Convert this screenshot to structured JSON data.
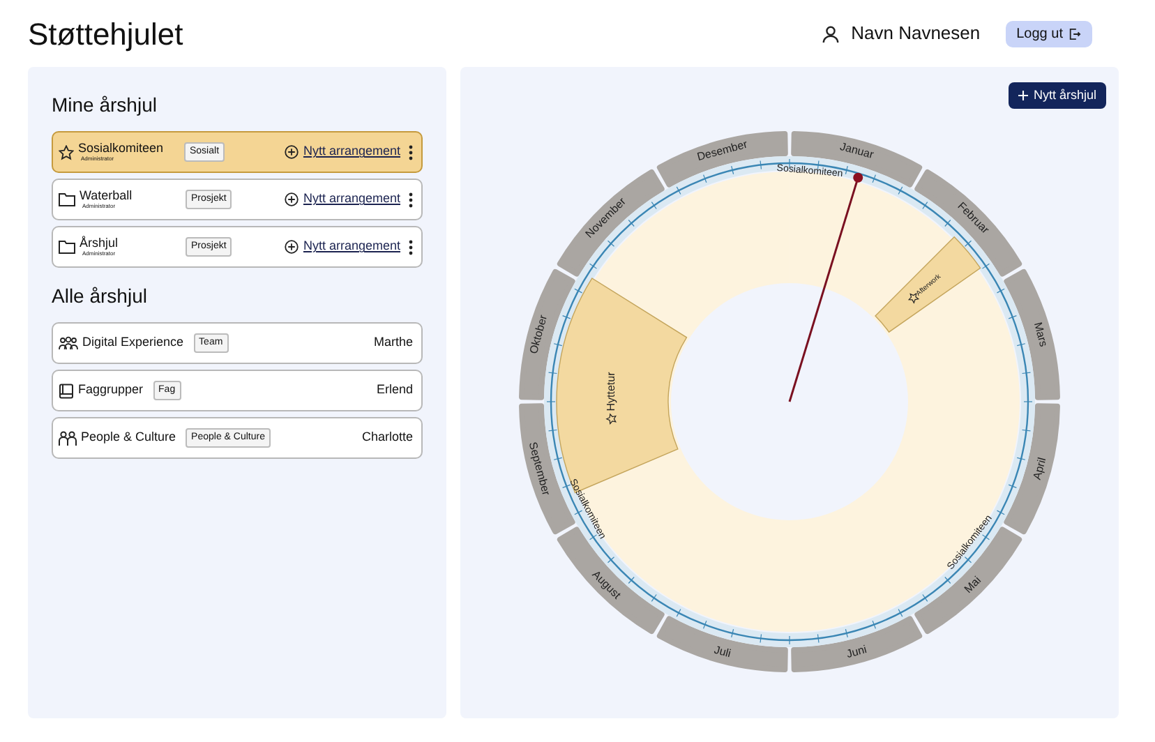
{
  "header": {
    "title": "Støttehjulet",
    "user": "Navn Navnesen",
    "logout": "Logg ut"
  },
  "my_wheels": {
    "heading": "Mine årshjul",
    "items": [
      {
        "name": "Sosialkomiteen",
        "role": "Administrator",
        "tag": "Sosialt",
        "action": "Nytt arrangement",
        "kind": "star",
        "selected": true
      },
      {
        "name": "Waterball",
        "role": "Administrator",
        "tag": "Prosjekt",
        "action": "Nytt arrangement",
        "kind": "folder",
        "selected": false
      },
      {
        "name": "Årshjul",
        "role": "Administrator",
        "tag": "Prosjekt",
        "action": "Nytt arrangement",
        "kind": "folder",
        "selected": false
      }
    ]
  },
  "all_wheels": {
    "heading": "Alle årshjul",
    "items": [
      {
        "name": "Digital Experience",
        "tag": "Team",
        "owner": "Marthe",
        "kind": "team"
      },
      {
        "name": "Faggrupper",
        "tag": "Fag",
        "owner": "Erlend",
        "kind": "book"
      },
      {
        "name": "People & Culture",
        "tag": "People & Culture",
        "owner": "Charlotte",
        "kind": "people"
      }
    ]
  },
  "wheel": {
    "new_button": "Nytt årshjul",
    "months": [
      "Januar",
      "Februar",
      "Mars",
      "April",
      "Mai",
      "Juni",
      "Juli",
      "August",
      "September",
      "Oktober",
      "November",
      "Desember"
    ],
    "ring_labels": [
      "Sosialkomiteen",
      "Sosialkomiteen",
      "Sosialkomiteen"
    ],
    "events": [
      {
        "title": "Afterwork"
      },
      {
        "title": "Hyttetur"
      }
    ]
  }
}
